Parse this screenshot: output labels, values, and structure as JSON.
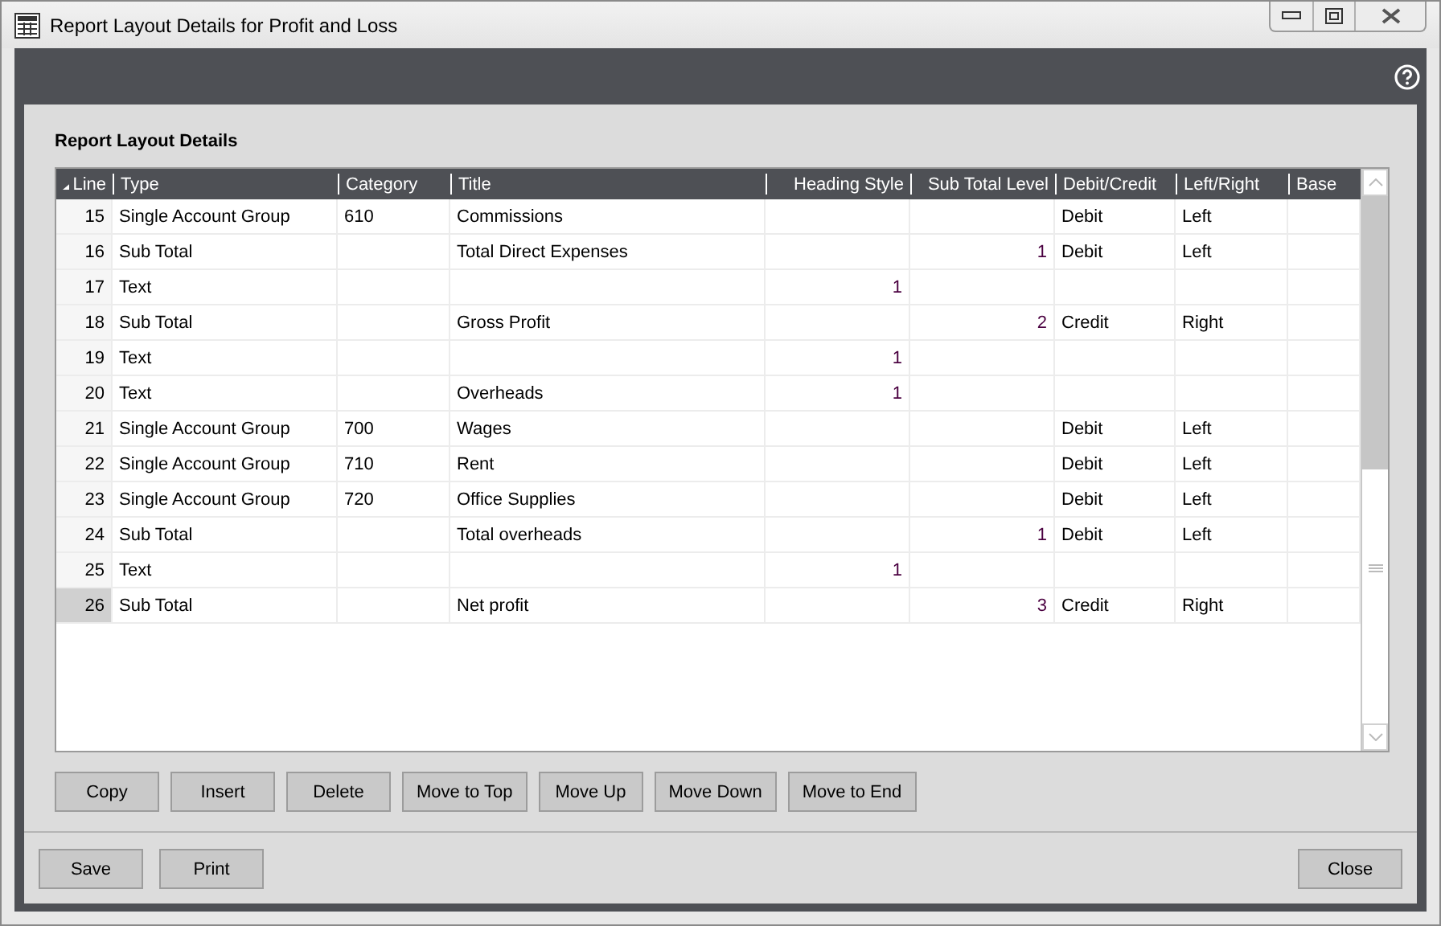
{
  "window": {
    "title": "Report Layout Details for Profit and Loss"
  },
  "section_title": "Report Layout Details",
  "table": {
    "columns": [
      {
        "label": "Line",
        "kind": "number",
        "sorted": true
      },
      {
        "label": "Type",
        "kind": "text",
        "sorted": false
      },
      {
        "label": "Category",
        "kind": "text",
        "sorted": false
      },
      {
        "label": "Title",
        "kind": "text",
        "sorted": false
      },
      {
        "label": "Heading Style",
        "kind": "number",
        "sorted": false
      },
      {
        "label": "Sub Total Level",
        "kind": "number",
        "sorted": false
      },
      {
        "label": "Debit/Credit",
        "kind": "text",
        "sorted": false
      },
      {
        "label": "Left/Right",
        "kind": "text",
        "sorted": false
      },
      {
        "label": "Base",
        "kind": "text",
        "sorted": false
      }
    ],
    "rows": [
      {
        "selected": false,
        "cells": [
          "15",
          "Single Account Group",
          "610",
          "Commissions",
          "",
          "",
          "Debit",
          "Left",
          ""
        ]
      },
      {
        "selected": false,
        "cells": [
          "16",
          "Sub Total",
          "",
          "Total Direct Expenses",
          "",
          "1",
          "Debit",
          "Left",
          ""
        ]
      },
      {
        "selected": false,
        "cells": [
          "17",
          "Text",
          "",
          "",
          "1",
          "",
          "",
          "",
          ""
        ]
      },
      {
        "selected": false,
        "cells": [
          "18",
          "Sub Total",
          "",
          "Gross Profit",
          "",
          "2",
          "Credit",
          "Right",
          ""
        ]
      },
      {
        "selected": false,
        "cells": [
          "19",
          "Text",
          "",
          "",
          "1",
          "",
          "",
          "",
          ""
        ]
      },
      {
        "selected": false,
        "cells": [
          "20",
          "Text",
          "",
          "Overheads",
          "1",
          "",
          "",
          "",
          ""
        ]
      },
      {
        "selected": false,
        "cells": [
          "21",
          "Single Account Group",
          "700",
          "Wages",
          "",
          "",
          "Debit",
          "Left",
          ""
        ]
      },
      {
        "selected": false,
        "cells": [
          "22",
          "Single Account Group",
          "710",
          "Rent",
          "",
          "",
          "Debit",
          "Left",
          ""
        ]
      },
      {
        "selected": false,
        "cells": [
          "23",
          "Single Account Group",
          "720",
          "Office Supplies",
          "",
          "",
          "Debit",
          "Left",
          ""
        ]
      },
      {
        "selected": false,
        "cells": [
          "24",
          "Sub Total",
          "",
          "Total overheads",
          "",
          "1",
          "Debit",
          "Left",
          ""
        ]
      },
      {
        "selected": false,
        "cells": [
          "25",
          "Text",
          "",
          "",
          "1",
          "",
          "",
          "",
          ""
        ]
      },
      {
        "selected": true,
        "cells": [
          "26",
          "Sub Total",
          "",
          "Net profit",
          "",
          "3",
          "Credit",
          "Right",
          ""
        ]
      }
    ]
  },
  "row_buttons": [
    "Copy",
    "Insert",
    "Delete",
    "Move to Top",
    "Move Up",
    "Move Down",
    "Move to End"
  ],
  "footer_buttons_left": [
    "Save",
    "Print"
  ],
  "footer_buttons_right": [
    "Close"
  ]
}
